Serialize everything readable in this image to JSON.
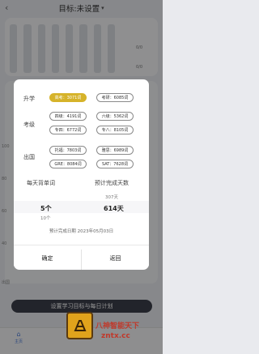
{
  "header": {
    "title": "目标:未设置",
    "back_glyph": "‹",
    "chevron_glyph": "▾"
  },
  "background": {
    "right_labels": [
      "0/0",
      "0/0"
    ],
    "y_ticks": [
      "100",
      "80",
      "60",
      "40"
    ],
    "bottom_label": "出国",
    "cta": "设置学习目标与每日计划",
    "tab_home": {
      "icon": "⌂",
      "label": "主页"
    }
  },
  "modal": {
    "groups": {
      "shengxue": {
        "label": "升学",
        "chips": [
          {
            "text": "高考：3071词",
            "selected": true
          },
          {
            "text": "考研：6085词",
            "selected": false
          }
        ]
      },
      "kaoji": {
        "label": "考级",
        "chips": [
          {
            "text": "四级：4191词",
            "selected": false
          },
          {
            "text": "六级：5362词",
            "selected": false
          },
          {
            "text": "专四：6772词",
            "selected": false
          },
          {
            "text": "专八：8105词",
            "selected": false
          }
        ]
      },
      "chuguo": {
        "label": "出国",
        "chips": [
          {
            "text": "托福：7803词",
            "selected": false
          },
          {
            "text": "雅思：6989词",
            "selected": false
          },
          {
            "text": "GRE：8084词",
            "selected": false
          },
          {
            "text": "SAT：7628词",
            "selected": false
          }
        ]
      }
    },
    "plan": {
      "left_header": "每天背单词",
      "right_header": "预计完成天数",
      "right_above": "307天",
      "left_value": "5个",
      "right_value": "614天",
      "left_below": "10个",
      "finish_date": "预计完成日期 2023年05月03日"
    },
    "buttons": {
      "confirm": "确定",
      "back": "返回"
    }
  },
  "watermark": {
    "title": "八神智能天下",
    "url": "zntx.cc"
  }
}
